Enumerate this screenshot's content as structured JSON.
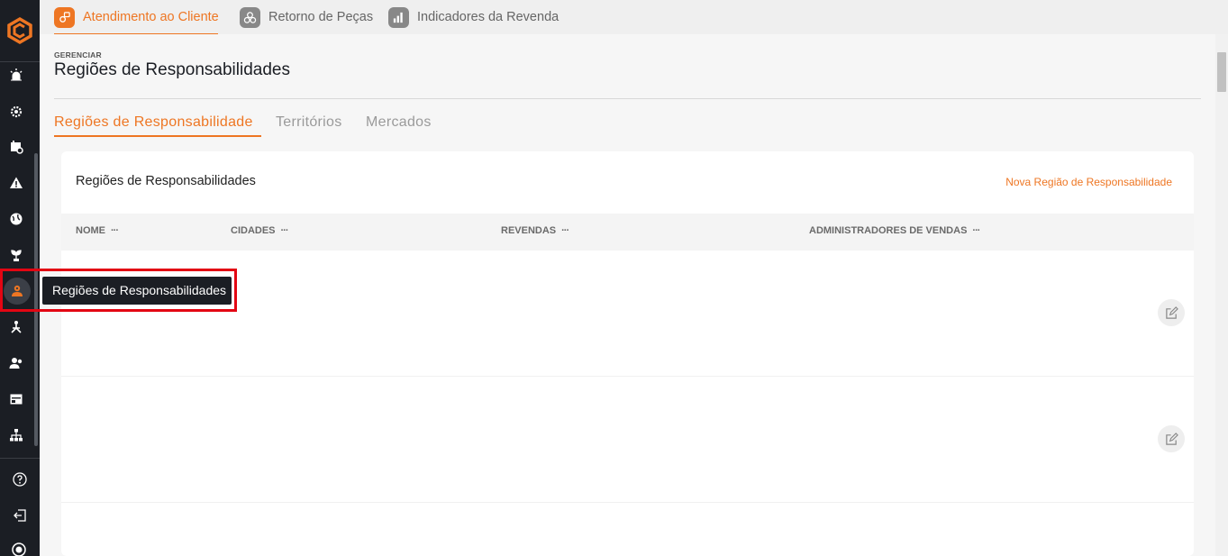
{
  "top_tabs": [
    {
      "label": "Atendimento ao Cliente",
      "active": true,
      "icon": "customer-service-icon"
    },
    {
      "label": "Retorno de Peças",
      "active": false,
      "icon": "parts-return-icon"
    },
    {
      "label": "Indicadores da Revenda",
      "active": false,
      "icon": "bar-chart-icon"
    }
  ],
  "page": {
    "eyebrow": "GERENCIAR",
    "title": "Regiões de Responsabilidades"
  },
  "sub_tabs": [
    {
      "label": "Regiões de Responsabilidade",
      "active": true
    },
    {
      "label": "Territórios",
      "active": false
    },
    {
      "label": "Mercados",
      "active": false
    }
  ],
  "card": {
    "title": "Regiões de Responsabilidades",
    "action": "Nova Região de Responsabilidade",
    "columns": [
      "NOME",
      "CIDADES",
      "REVENDAS",
      "ADMINISTRADORES DE VENDAS"
    ],
    "column_menu": "···"
  },
  "tooltip": "Regiões de Responsabilidades",
  "colors": {
    "accent": "#ee7623",
    "sidebar": "#1b1e24",
    "highlight": "#e30613"
  }
}
